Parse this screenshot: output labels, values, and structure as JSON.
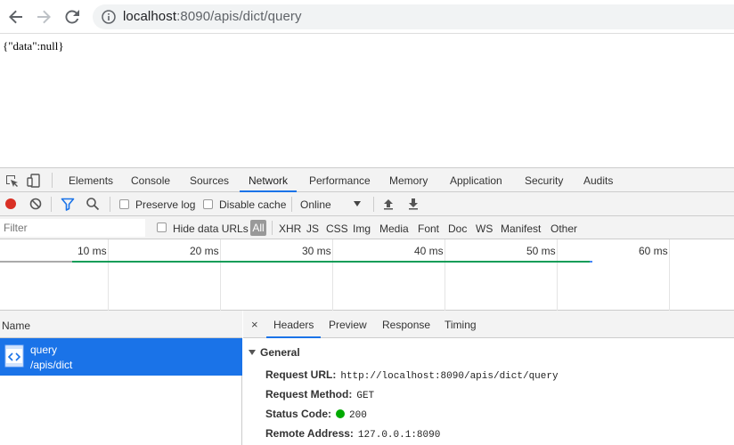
{
  "browser": {
    "url_host": "localhost",
    "url_rest": ":8090/apis/dict/query",
    "icons": {
      "back": "back-arrow-icon",
      "forward": "forward-arrow-icon",
      "reload": "reload-icon",
      "info": "info-icon"
    }
  },
  "page": {
    "body_text": "{\"data\":null}"
  },
  "devtools": {
    "tabs": [
      "Elements",
      "Console",
      "Sources",
      "Network",
      "Performance",
      "Memory",
      "Application",
      "Security",
      "Audits"
    ],
    "active_tab": "Network",
    "toolbar": {
      "preserve_log": "Preserve log",
      "disable_cache": "Disable cache",
      "throttle": "Online"
    },
    "filter": {
      "placeholder": "Filter",
      "hide_data_urls": "Hide data URLs",
      "all": "All",
      "types": [
        "XHR",
        "JS",
        "CSS",
        "Img",
        "Media",
        "Font",
        "Doc",
        "WS",
        "Manifest",
        "Other"
      ]
    },
    "timeline": {
      "ticks": [
        "10 ms",
        "20 ms",
        "30 ms",
        "40 ms",
        "50 ms",
        "60 ms"
      ],
      "colors": {
        "grey": "#aaaaaa",
        "green": "#0f9d58",
        "blue": "#4285f4"
      }
    },
    "requests": {
      "column": "Name",
      "rows": [
        {
          "name": "query",
          "path": "/apis/dict"
        }
      ]
    },
    "details": {
      "close": "×",
      "tabs": [
        "Headers",
        "Preview",
        "Response",
        "Timing"
      ],
      "active_tab": "Headers",
      "section": "General",
      "rows": [
        {
          "key": "Request URL:",
          "value": "http://localhost:8090/apis/dict/query"
        },
        {
          "key": "Request Method:",
          "value": "GET"
        },
        {
          "key": "Status Code:",
          "value": "200"
        },
        {
          "key": "Remote Address:",
          "value": "127.0.0.1:8090"
        }
      ]
    }
  },
  "colors": {
    "accent": "#1a73e8",
    "record": "#d93025",
    "status_ok": "#00aa00"
  }
}
